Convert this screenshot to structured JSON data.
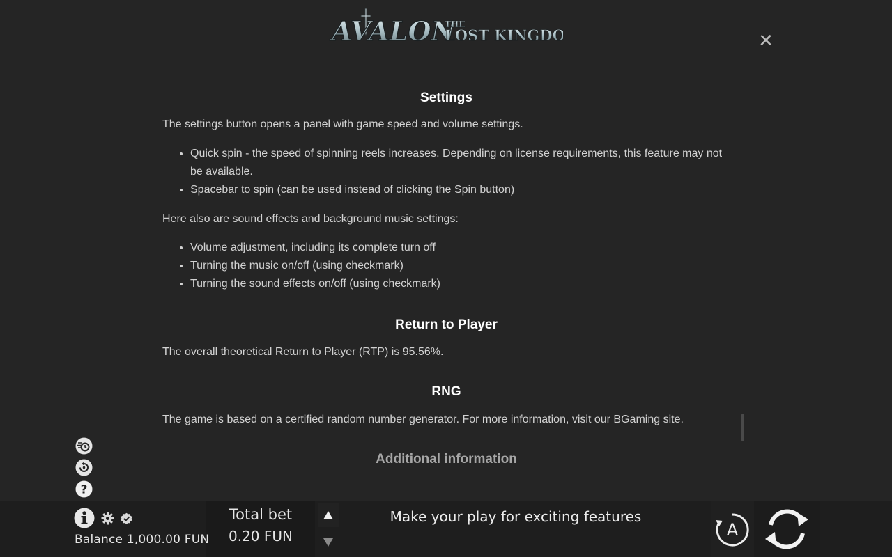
{
  "header": {
    "logo_main": "AVALON",
    "logo_the": "THE",
    "logo_sub": "LOST KINGDOM"
  },
  "content": {
    "settings_title": "Settings",
    "settings_intro": "The settings button opens a panel with game speed and volume settings.",
    "settings_items": [
      "Quick spin - the speed of spinning reels increases. Depending on license requirements, this feature may not be available.",
      "Spacebar to spin (can be used instead of clicking the Spin button)"
    ],
    "sound_intro": "Here also are sound effects and background music settings:",
    "sound_items": [
      "Volume adjustment, including its complete turn off",
      "Turning the music on/off (using checkmark)",
      "Turning the sound effects on/off (using checkmark)"
    ],
    "rtp_title": "Return to Player",
    "rtp_text": "The overall theoretical Return to Player (RTP) is 95.56%.",
    "rng_title": "RNG",
    "rng_text": "The game is based on a certified random number generator. For more information, visit our BGaming site.",
    "additional_title": "Additional information"
  },
  "bottom_bar": {
    "balance_label": "Balance",
    "balance_value": "1,000.00 FUN",
    "total_bet_label": "Total bet",
    "total_bet_value": "0.20 FUN",
    "message": "Make your play for exciting features",
    "auto_label": "A"
  },
  "icons": {
    "close": "close-icon",
    "quick_spin": "quick-spin-icon",
    "turbo": "turbo-icon",
    "help": "help-icon",
    "info": "info-icon",
    "settings": "gear-icon",
    "verified": "verified-badge-icon",
    "bet_up": "arrow-up-icon",
    "bet_down": "arrow-down-icon",
    "autoplay": "autoplay-icon",
    "spin": "spin-icon"
  },
  "colors": {
    "background": "#252525",
    "bar_background": "#1e1e1e",
    "text": "#d2d2d2",
    "heading": "#ffffff"
  }
}
